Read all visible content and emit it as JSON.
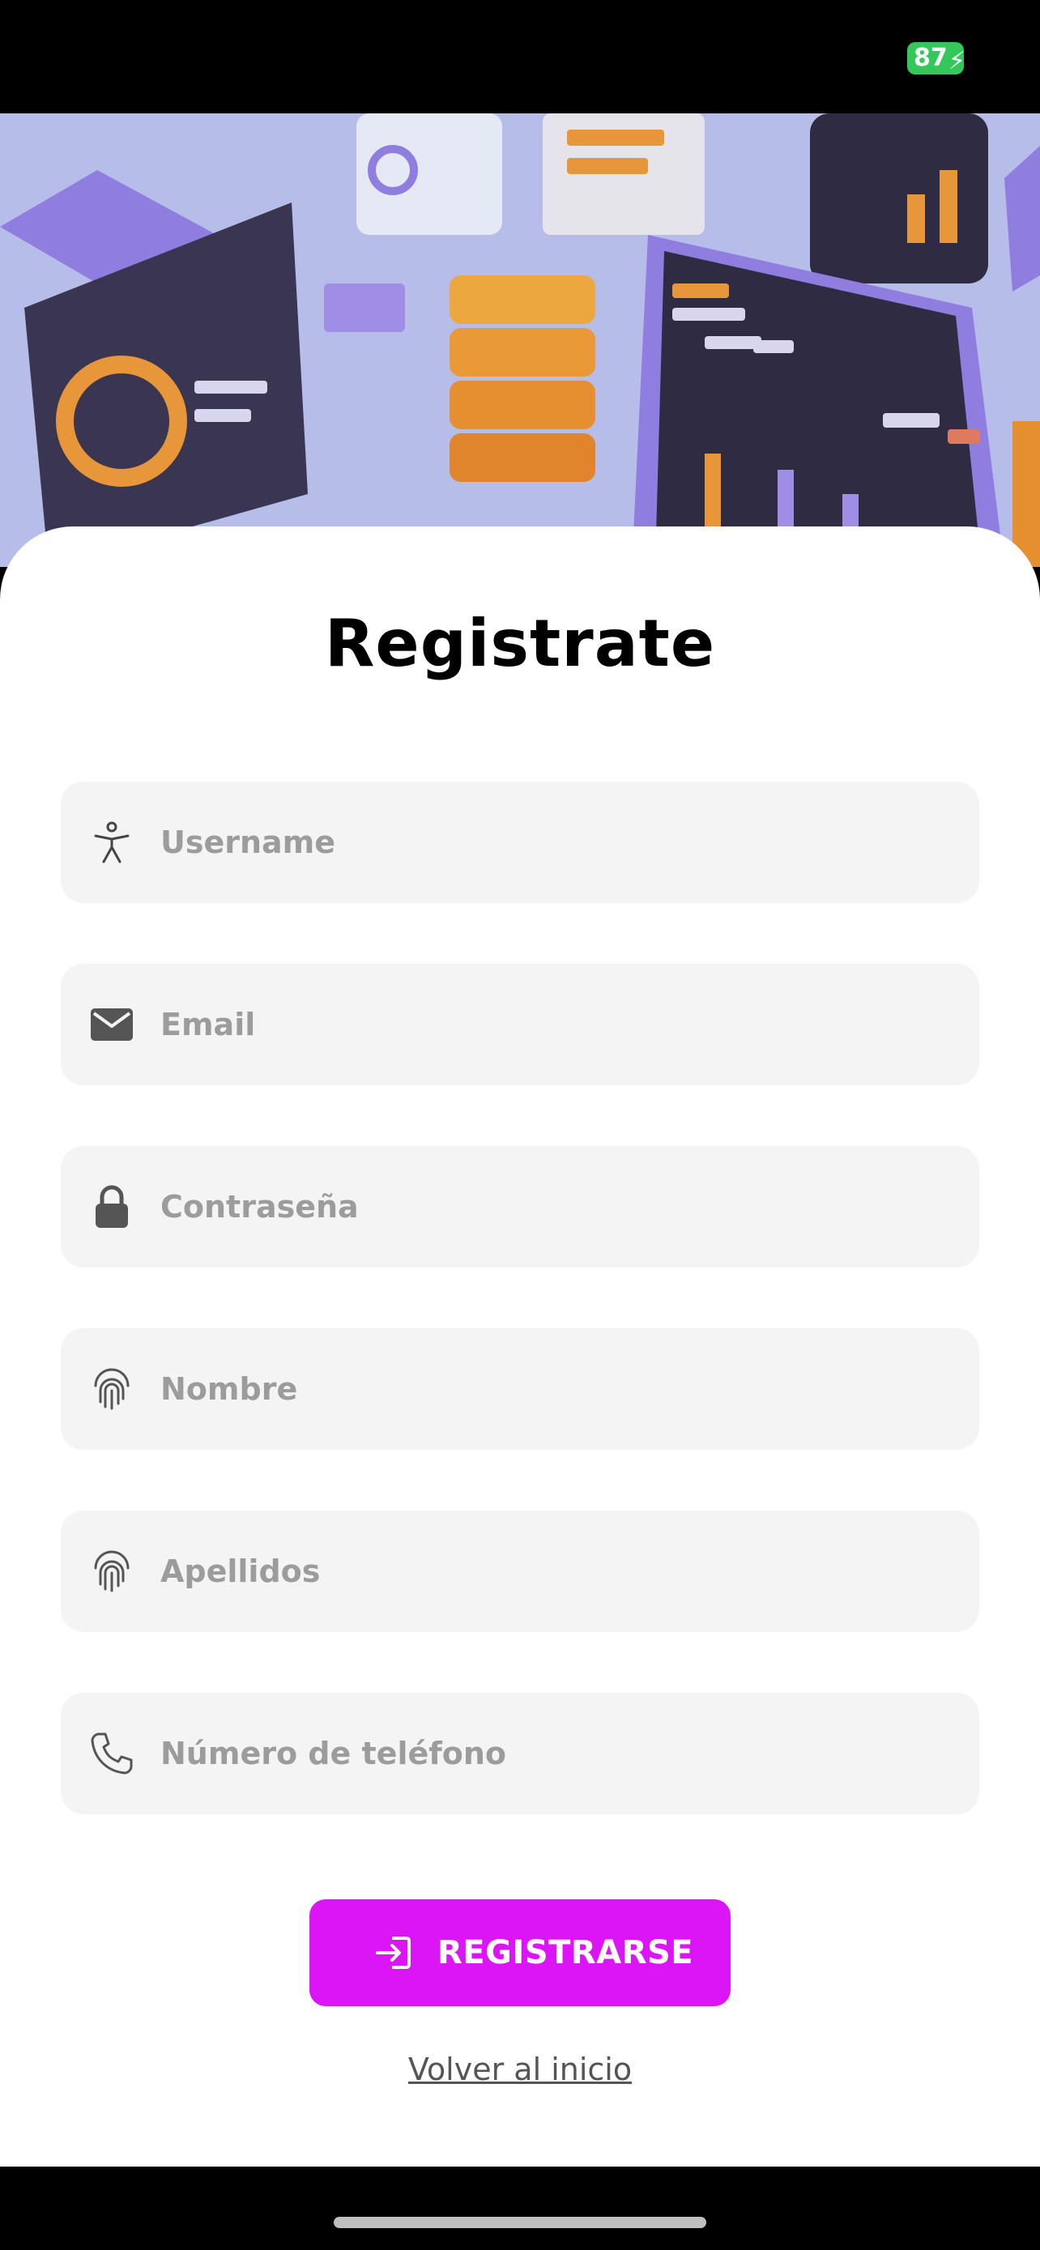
{
  "status": {
    "battery": "87"
  },
  "page": {
    "title": "Registrate"
  },
  "form": {
    "fields": [
      {
        "placeholder": "Username",
        "icon": "accessibility-person-icon"
      },
      {
        "placeholder": "Email",
        "icon": "envelope-icon"
      },
      {
        "placeholder": "Contraseña",
        "icon": "lock-icon"
      },
      {
        "placeholder": "Nombre",
        "icon": "fingerprint-icon"
      },
      {
        "placeholder": "Apellidos",
        "icon": "fingerprint-icon"
      },
      {
        "placeholder": "Número de teléfono",
        "icon": "phone-icon"
      }
    ],
    "submit_label": "REGISTRARSE",
    "back_link": "Volver al inicio"
  },
  "colors": {
    "accent": "#dc15f7",
    "field_bg": "#f4f4f4",
    "placeholder": "#9c9c9c",
    "battery": "#34c759"
  }
}
